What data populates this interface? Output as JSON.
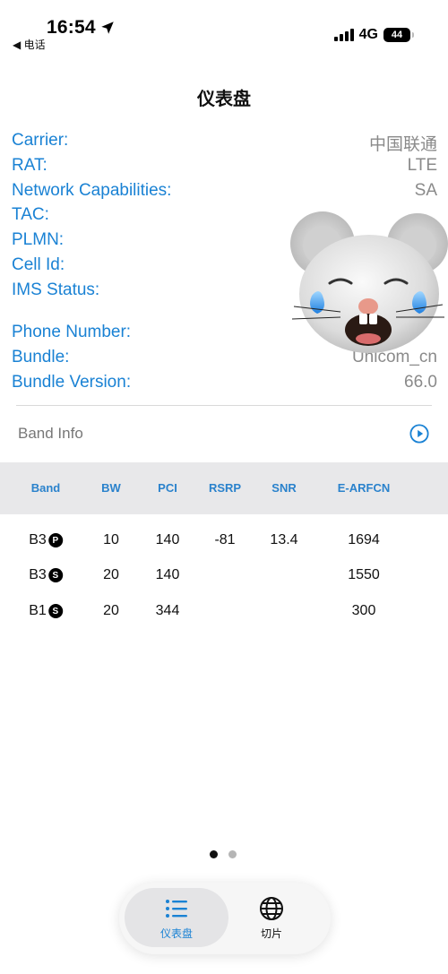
{
  "status_bar": {
    "time": "16:54",
    "back_label": "◀ 电话",
    "network": "4G",
    "battery": "44"
  },
  "header": {
    "title": "仪表盘"
  },
  "info_rows": [
    {
      "label": "Carrier:",
      "value": "中国联通"
    },
    {
      "label": "RAT:",
      "value": "LTE"
    },
    {
      "label": "Network Capabilities:",
      "value": "SA"
    },
    {
      "label": "TAC:",
      "value": ""
    },
    {
      "label": "PLMN:",
      "value": ""
    },
    {
      "label": "Cell Id:",
      "value": ""
    },
    {
      "label": "IMS Status:",
      "value": ""
    },
    {
      "label": "Phone Number:",
      "value": ""
    },
    {
      "label": "Bundle:",
      "value": "Unicom_cn"
    },
    {
      "label": "Bundle Version:",
      "value": "66.0"
    }
  ],
  "band_section": {
    "title": "Band Info"
  },
  "band_table": {
    "columns": [
      "Band",
      "BW",
      "PCI",
      "RSRP",
      "SNR",
      "E-ARFCN"
    ],
    "rows": [
      {
        "band": "B3",
        "badge": "P",
        "bw": "10",
        "pci": "140",
        "rsrp": "-81",
        "snr": "13.4",
        "earfcn": "1694"
      },
      {
        "band": "B3",
        "badge": "S",
        "bw": "20",
        "pci": "140",
        "rsrp": "",
        "snr": "",
        "earfcn": "1550"
      },
      {
        "band": "B1",
        "badge": "S",
        "bw": "20",
        "pci": "344",
        "rsrp": "",
        "snr": "",
        "earfcn": "300"
      }
    ]
  },
  "tabbar": {
    "tabs": [
      {
        "label": "仪表盘",
        "icon": "list-icon",
        "active": true
      },
      {
        "label": "切片",
        "icon": "globe-icon",
        "active": false
      }
    ]
  },
  "page_indicator": {
    "count": 2,
    "active": 0
  },
  "colors": {
    "accent": "#1a82d4",
    "value_gray": "#8a8a8a",
    "table_header_bg": "#e8e8ea"
  }
}
